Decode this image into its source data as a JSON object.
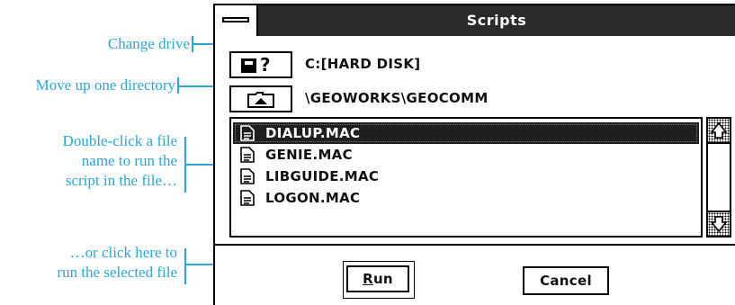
{
  "window": {
    "title": "Scripts"
  },
  "callouts": {
    "change_drive": "Change drive",
    "move_up": "Move up one directory",
    "double_click_line1": "Double-click a file",
    "double_click_line2": "name to run the",
    "double_click_line3": "script in the file…",
    "run_selected_line1": "…or click here to",
    "run_selected_line2": "run the selected file"
  },
  "drive": {
    "button_icon": "drive-icon",
    "button_glyph": "?",
    "label": "C:[HARD DISK]"
  },
  "directory": {
    "button_icon": "folder-up-icon",
    "path": "\\GEOWORKS\\GEOCOMM"
  },
  "files": {
    "items": [
      {
        "name": "DIALUP.MAC",
        "selected": true
      },
      {
        "name": "GENIE.MAC",
        "selected": false
      },
      {
        "name": "LIBGUIDE.MAC",
        "selected": false
      },
      {
        "name": "LOGON.MAC",
        "selected": false
      }
    ]
  },
  "buttons": {
    "run_mnemonic": "R",
    "run_rest": "un",
    "cancel": "Cancel"
  },
  "colors": {
    "callout": "#2aa6d8",
    "titlebar": "#2a2a2a",
    "selection": "#1f1f1f"
  }
}
